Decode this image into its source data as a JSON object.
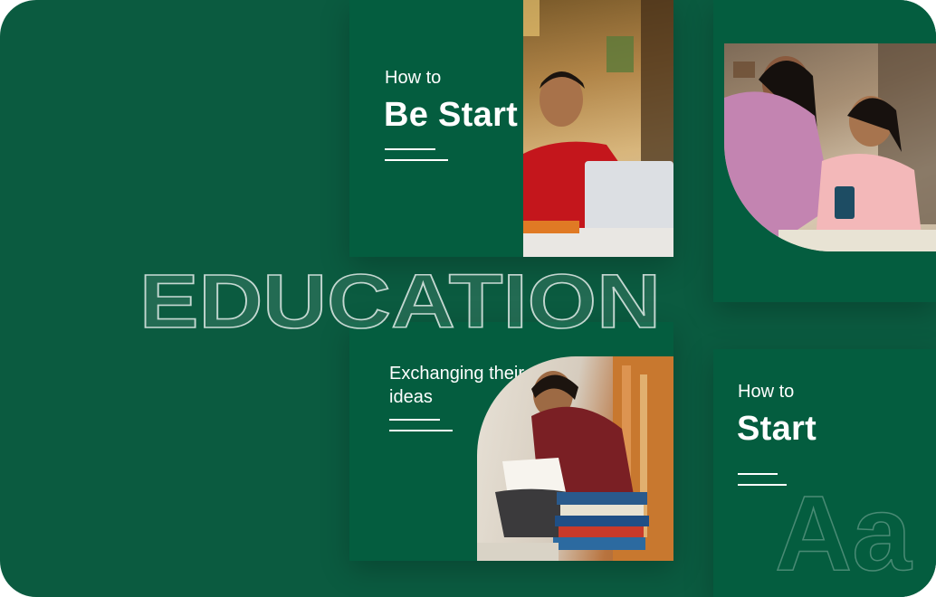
{
  "cards": {
    "be_start": {
      "line1": "How to",
      "line2": "Be Start"
    },
    "exchanging": {
      "text": "Exchanging their ideas"
    },
    "start": {
      "line1": "How to",
      "line2": "Start"
    }
  },
  "watermark": {
    "education": "EDUCATION",
    "typeface_sample": "Aa"
  },
  "images": {
    "man_laptop": "man-at-laptop-photo",
    "mother_daughter": "mother-daughter-phone-photo",
    "student_library": "student-reading-library-photo"
  },
  "colors": {
    "background": "#0b5b40",
    "card": "#045d3f",
    "text": "#ffffff"
  }
}
